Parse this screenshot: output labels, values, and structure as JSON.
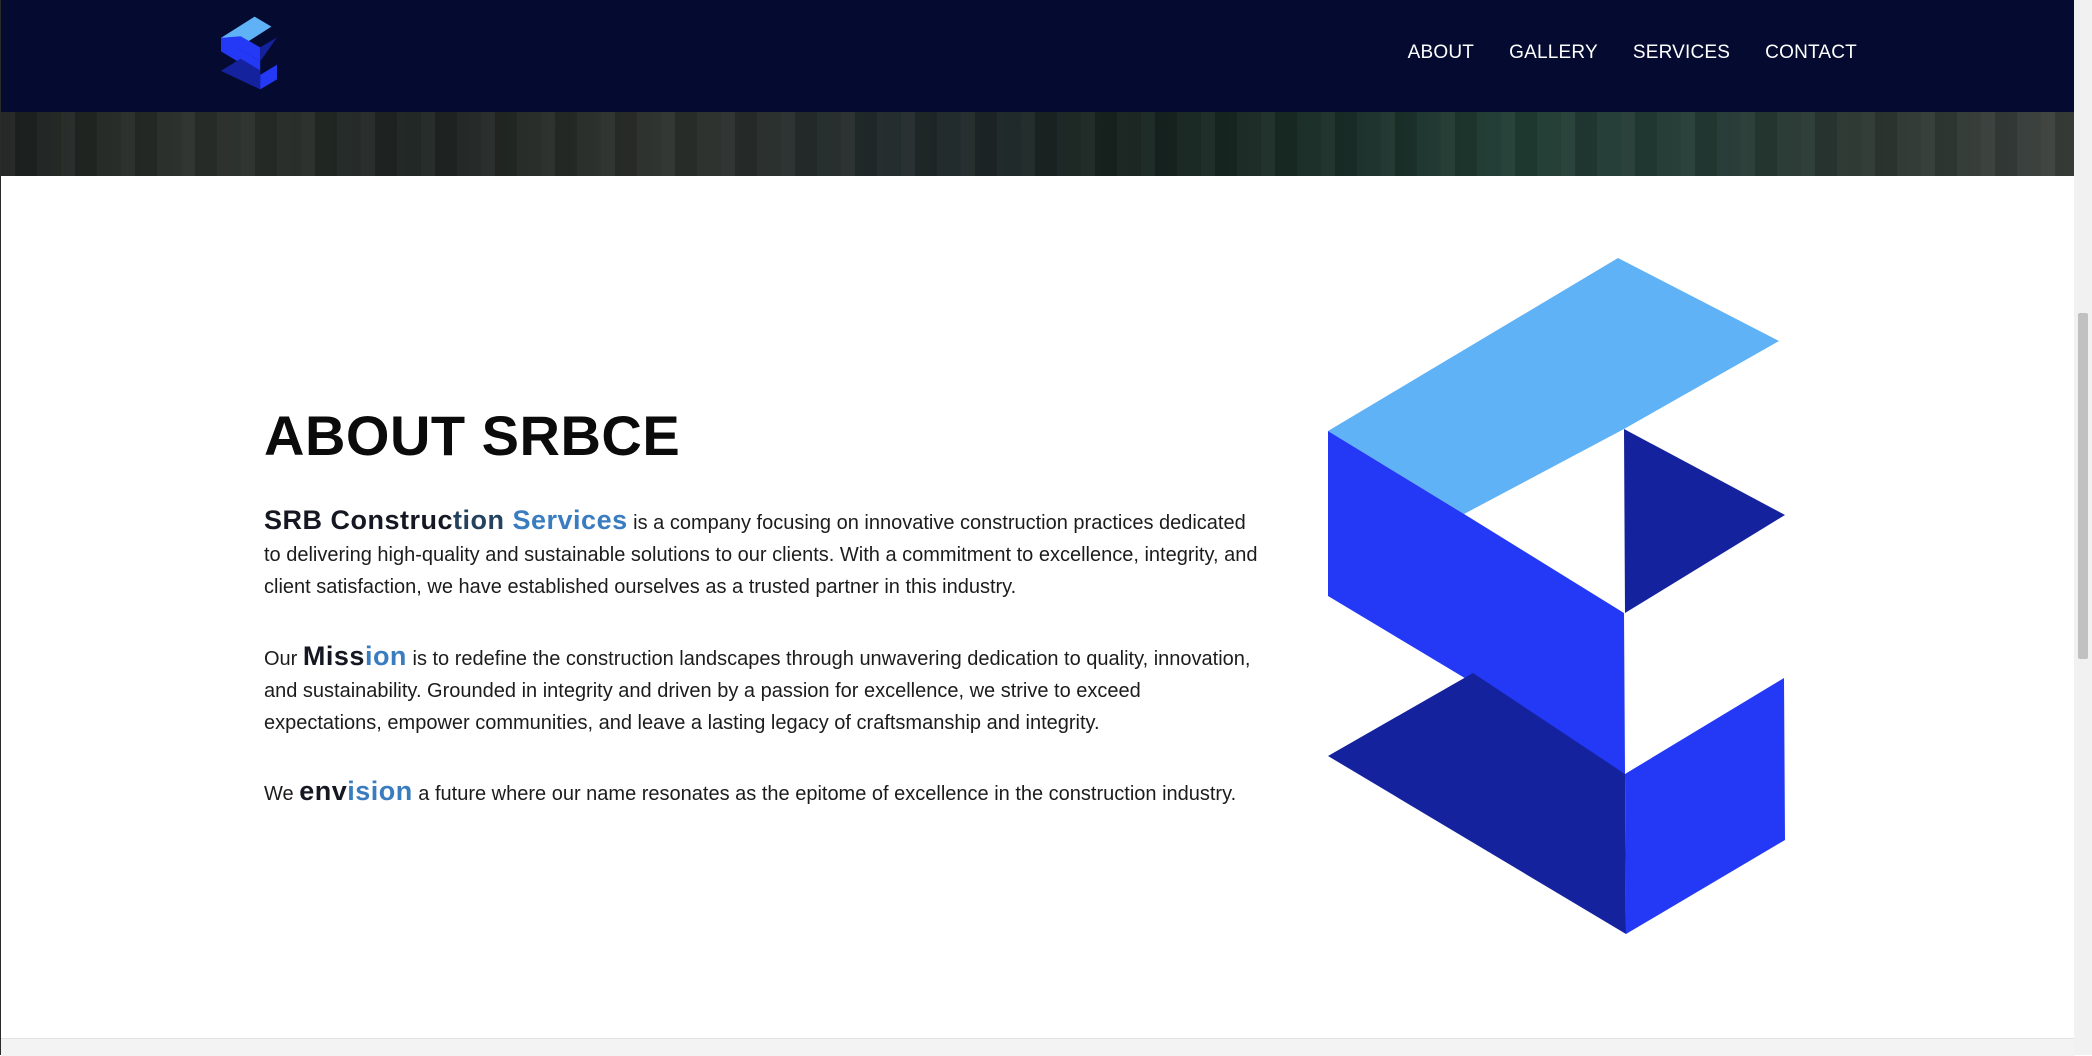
{
  "nav": {
    "items": [
      {
        "label": "ABOUT"
      },
      {
        "label": "GALLERY"
      },
      {
        "label": "SERVICES"
      },
      {
        "label": "CONTACT"
      }
    ]
  },
  "colors": {
    "navbar_bg": "#050b30",
    "logo_light": "#60b2f6",
    "logo_mid": "#2339f6",
    "logo_dark": "#14229e",
    "accent_text": "#3a7cc0"
  },
  "about": {
    "title": "ABOUT SRBCE",
    "p1": {
      "highlight_dark": "SRB Construc",
      "highlight_dark2": "tion ",
      "highlight_light": "Services",
      "text": " is a company focusing on innovative construction practices dedicated to delivering high-quality and sustainable solutions to our clients. With a commitment to excellence, integrity, and client satisfaction, we have established ourselves as a trusted partner in this industry."
    },
    "p2": {
      "prefix": "Our ",
      "highlight_dark": "Miss",
      "highlight_light": "ion",
      "text": " is to redefine the construction landscapes through unwavering dedication to quality, innovation, and sustainability. Grounded in integrity and driven by a passion for excellence, we strive to exceed expectations, empower communities, and leave a lasting legacy of craftsmanship and integrity."
    },
    "p3": {
      "prefix": "We ",
      "highlight_dark": "env",
      "highlight_light": "ision",
      "text": " a future where our name resonates as the epitome of excellence in the construction industry."
    }
  }
}
